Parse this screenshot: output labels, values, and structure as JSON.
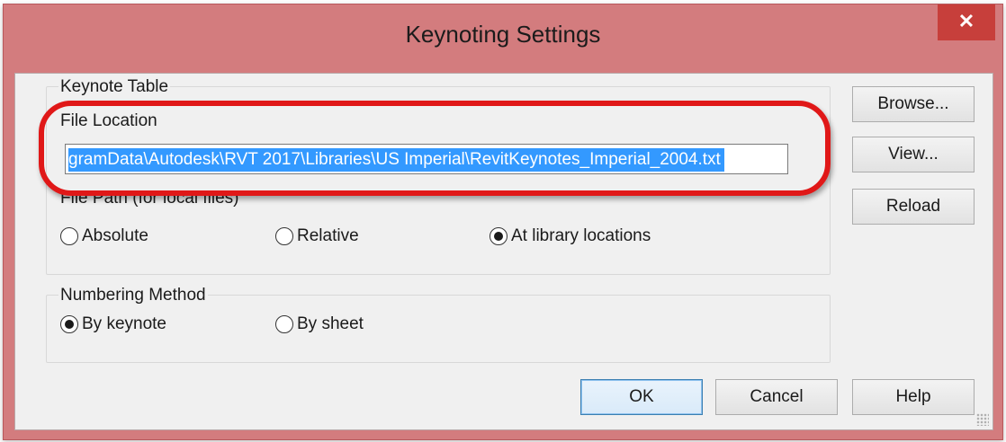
{
  "window": {
    "title": "Keynoting Settings",
    "close_glyph": "✕"
  },
  "keynote_table": {
    "legend": "Keynote Table",
    "file_location_label": "File Location",
    "file_location_value": "gramData\\Autodesk\\RVT 2017\\Libraries\\US Imperial\\RevitKeynotes_Imperial_2004.txt",
    "file_path_label": "File Path (for local files)",
    "path_options": [
      {
        "label": "Absolute",
        "checked": false
      },
      {
        "label": "Relative",
        "checked": false
      },
      {
        "label": "At library locations",
        "checked": true
      }
    ]
  },
  "numbering_method": {
    "legend": "Numbering Method",
    "options": [
      {
        "label": "By keynote",
        "checked": true
      },
      {
        "label": "By sheet",
        "checked": false
      }
    ]
  },
  "side_buttons": {
    "browse": "Browse...",
    "view": "View...",
    "reload": "Reload"
  },
  "footer_buttons": {
    "ok": "OK",
    "cancel": "Cancel",
    "help": "Help"
  },
  "colors": {
    "titlebar": "#d37c7e",
    "close_button": "#c73f3b",
    "selection": "#3399ff",
    "highlight_ring": "#e01818"
  }
}
